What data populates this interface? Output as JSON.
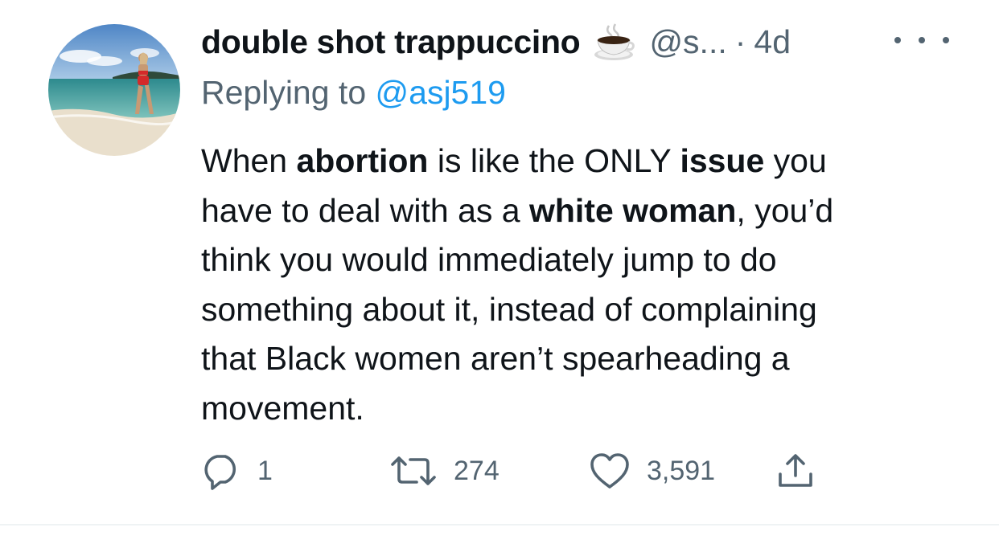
{
  "tweet": {
    "author": {
      "display_name": "double shot trappuccino",
      "emoji": "coffee-cup-emoji",
      "handle": "@s...",
      "separator": "·",
      "time": "4d",
      "avatar": "avatar-beach-photo"
    },
    "reply": {
      "prefix": "Replying to ",
      "mention": "@asj519"
    },
    "body": {
      "lines": [
        [
          {
            "text": "When ",
            "bold": false
          },
          {
            "text": "abortion",
            "bold": true
          },
          {
            "text": " is like the ONLY ",
            "bold": false
          },
          {
            "text": "issue",
            "bold": true
          },
          {
            "text": " you",
            "bold": false
          }
        ],
        [
          {
            "text": "have to deal with as a ",
            "bold": false
          },
          {
            "text": "white woman",
            "bold": true
          },
          {
            "text": ", you’d",
            "bold": false
          }
        ],
        [
          {
            "text": "think you would immediately jump to do",
            "bold": false
          }
        ],
        [
          {
            "text": "something about it, instead of complaining",
            "bold": false
          }
        ],
        [
          {
            "text": "that Black women aren’t spearheading a",
            "bold": false
          }
        ],
        [
          {
            "text": "movement.",
            "bold": false
          }
        ]
      ]
    },
    "actions": {
      "reply_count": "1",
      "retweet_count": "274",
      "like_count": "3,591"
    },
    "icons": {
      "more": "more-options-icon",
      "reply": "reply-icon",
      "retweet": "retweet-icon",
      "like": "heart-icon",
      "share": "share-icon"
    },
    "colors": {
      "text": "#0f1419",
      "secondary": "#536471",
      "accent": "#1d9bf0",
      "divider": "#eff3f4"
    }
  }
}
